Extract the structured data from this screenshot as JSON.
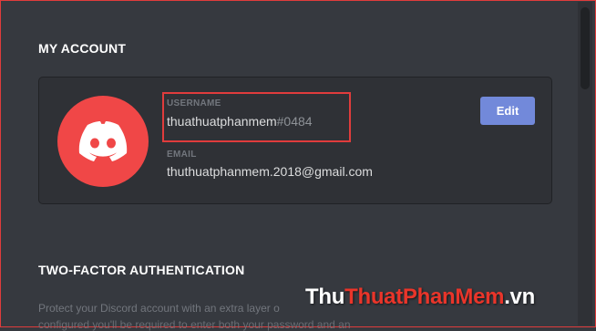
{
  "account": {
    "section_title": "MY ACCOUNT",
    "username_label": "USERNAME",
    "username": "thuathuatphanmem",
    "discriminator": "#0484",
    "email_label": "EMAIL",
    "email": "thuthuatphanmem.2018@gmail.com",
    "edit_label": "Edit",
    "avatar_icon": "discord-logo-icon"
  },
  "two_factor": {
    "section_title": "TWO-FACTOR AUTHENTICATION",
    "description_line1": "Protect your Discord account with an extra layer o",
    "description_line2": "configured you'll be required to enter both your password and an"
  },
  "watermark": {
    "part1": "Thu",
    "part2": "Thuat",
    "part3": "PhanMem",
    "part4": ".vn"
  },
  "colors": {
    "background": "#36393f",
    "card": "#2f3136",
    "avatar": "#f04747",
    "button": "#7289da",
    "highlight": "#e03c3c"
  }
}
